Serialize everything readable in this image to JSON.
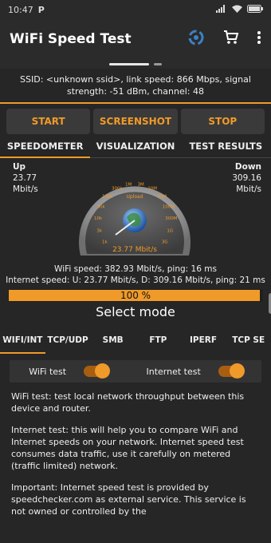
{
  "status_bar": {
    "time": "10:47",
    "left_icon": "P",
    "right_icons": [
      "signal-bars-icon",
      "wifi-icon",
      "battery-icon"
    ]
  },
  "appbar": {
    "title": "WiFi Speed Test",
    "icons": [
      "refresh-icon",
      "cart-icon",
      "overflow-menu-icon"
    ]
  },
  "ssid_info": "SSID: <unknown ssid>, link speed: 866 Mbps, signal strength: -51 dBm, channel: 48",
  "buttons": {
    "start": "START",
    "screenshot": "SCREENSHOT",
    "stop": "STOP"
  },
  "tabs": [
    "SPEEDOMETER",
    "VISUALIZATION",
    "TEST RESULTS"
  ],
  "up": {
    "label": "Up",
    "value": "23.77",
    "unit": "Mbit/s"
  },
  "down": {
    "label": "Down",
    "value": "309.16",
    "unit": "Mbit/s"
  },
  "gauge": {
    "label": "Upload",
    "reading": "23.77 Mbit/s",
    "ticks": [
      "1k",
      "3k",
      "10k",
      "30k",
      "100k",
      "300k",
      "1M",
      "3M",
      "10M",
      "30M",
      "100M",
      "300M",
      "1G",
      "3G"
    ]
  },
  "wifi_speed": "WiFi speed: 382.93 Mbit/s, ping: 16 ms",
  "internet_speed": "Internet speed: U: 23.77 Mbit/s, D: 309.16 Mbit/s, ping: 21 ms",
  "progress": {
    "text": "100 %",
    "value": 1.0
  },
  "select_mode": "Select mode",
  "mode_tabs": [
    "WIFI/INT",
    "TCP/UDP",
    "SMB",
    "FTP",
    "IPERF",
    "TCP SE"
  ],
  "toggles": {
    "wifi_test": "WiFi test",
    "internet_test": "Internet test"
  },
  "description": {
    "p1": "WiFi test: test local network throughput between this device and router.",
    "p2": "Internet test: this will help you to compare WiFi and Internet speeds on your network. Internet speed test consumes data traffic, use it carefully on metered (traffic limited) network.",
    "p3": "Important: Internet speed test is provided by speedchecker.com as external service. This service is not owned or controlled by the"
  },
  "colors": {
    "accent": "#f09a2a",
    "background": "#262626"
  }
}
